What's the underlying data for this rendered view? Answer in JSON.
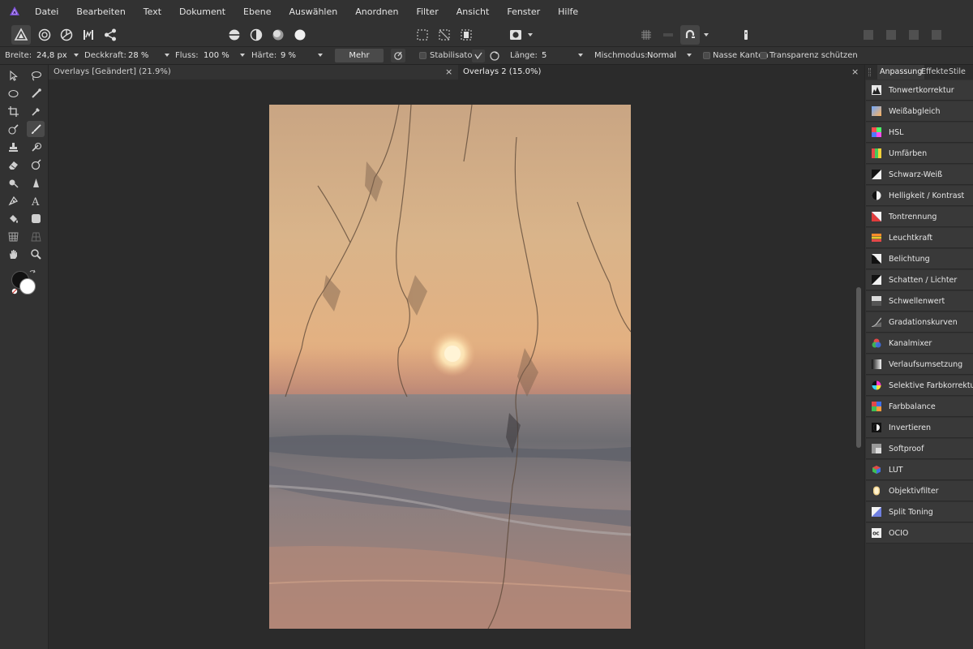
{
  "app": {
    "accent": "#8a5cf6"
  },
  "menubar": {
    "items": [
      "Datei",
      "Bearbeiten",
      "Text",
      "Dokument",
      "Ebene",
      "Auswählen",
      "Anordnen",
      "Filter",
      "Ansicht",
      "Fenster",
      "Hilfe"
    ]
  },
  "toolbar": {
    "personas": [
      "photo-persona-icon",
      "liquify-persona-icon",
      "develop-persona-icon",
      "tone-mapping-persona-icon",
      "export-persona-icon"
    ],
    "view_modes": [
      "split-horizontal-icon",
      "half-circle-icon",
      "shadow-circle-icon",
      "full-circle-icon"
    ],
    "selection_modes": [
      "marquee-icon",
      "crop-select-icon",
      "mask-icon"
    ],
    "quickmask": "quick-mask-icon",
    "snap_icons": [
      "grid-icon",
      "snap-line-icon",
      "magnet-icon"
    ],
    "assistant": "assistant-icon",
    "right_icons": [
      "arrange-a-icon",
      "arrange-b-icon",
      "arrange-c-icon",
      "arrange-d-icon"
    ]
  },
  "context": {
    "width_label": "Breite:",
    "width_value": "24,8 px",
    "opacity_label": "Deckkraft:",
    "opacity_value": "28 %",
    "flow_label": "Fluss:",
    "flow_value": "100 %",
    "hardness_label": "Härte:",
    "hardness_value": "9 %",
    "more_label": "Mehr",
    "stabilizer_label": "Stabilisator",
    "length_label": "Länge:",
    "length_value": "5",
    "blend_label": "Mischmodus:",
    "blend_value": "Normal",
    "wet_edges_label": "Nasse Kanten",
    "protect_alpha_label": "Transparenz schützen"
  },
  "tabs": [
    {
      "label": "Overlays [Geändert] (21.9%)",
      "close": "×",
      "active": false
    },
    {
      "label": "Overlays 2 (15.0%)",
      "close": "×",
      "active": true
    }
  ],
  "panel": {
    "tabs": [
      "Anpassung",
      "Effekte",
      "Stile"
    ],
    "items": [
      {
        "label": "Tonwertkorrektur",
        "icon": "levels-icon"
      },
      {
        "label": "Weißabgleich",
        "icon": "white-balance-icon"
      },
      {
        "label": "HSL",
        "icon": "hsl-icon"
      },
      {
        "label": "Umfärben",
        "icon": "recolor-icon"
      },
      {
        "label": "Schwarz-Weiß",
        "icon": "black-white-icon"
      },
      {
        "label": "Helligkeit / Kontrast",
        "icon": "brightness-contrast-icon"
      },
      {
        "label": "Tontrennung",
        "icon": "posterize-icon"
      },
      {
        "label": "Leuchtkraft",
        "icon": "vibrance-icon"
      },
      {
        "label": "Belichtung",
        "icon": "exposure-icon"
      },
      {
        "label": "Schatten / Lichter",
        "icon": "shadows-highlights-icon"
      },
      {
        "label": "Schwellenwert",
        "icon": "threshold-icon"
      },
      {
        "label": "Gradationskurven",
        "icon": "curves-icon"
      },
      {
        "label": "Kanalmixer",
        "icon": "channel-mixer-icon"
      },
      {
        "label": "Verlaufsumsetzung",
        "icon": "gradient-map-icon"
      },
      {
        "label": "Selektive Farbkorrektur",
        "icon": "selective-color-icon"
      },
      {
        "label": "Farbbalance",
        "icon": "color-balance-icon"
      },
      {
        "label": "Invertieren",
        "icon": "invert-icon"
      },
      {
        "label": "Softproof",
        "icon": "soft-proof-icon"
      },
      {
        "label": "LUT",
        "icon": "lut-icon"
      },
      {
        "label": "Objektivfilter",
        "icon": "lens-filter-icon"
      },
      {
        "label": "Split Toning",
        "icon": "split-toning-icon"
      },
      {
        "label": "OCIO",
        "icon": "ocio-icon"
      }
    ]
  },
  "colors": {
    "primary": "#111111",
    "secondary": "#ffffff"
  }
}
